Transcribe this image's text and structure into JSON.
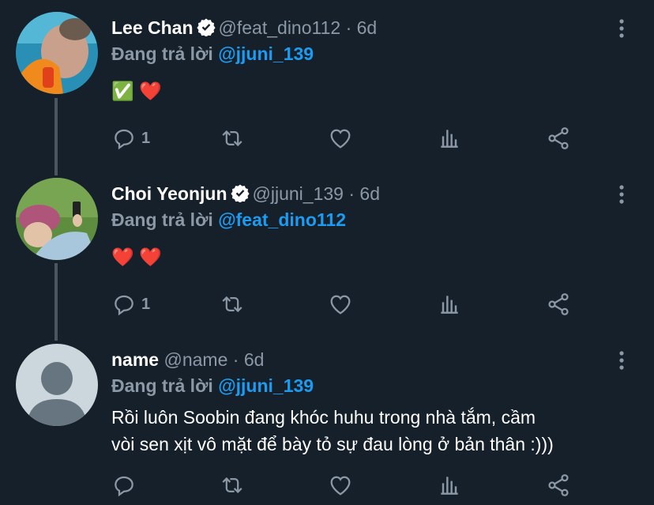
{
  "tweets": [
    {
      "name": "Lee Chan",
      "handle": "@feat_dino112",
      "separator": "·",
      "time": "6d",
      "replying_prefix": "Đang trả lời",
      "replying_to": "@jjuni_139",
      "content": "✅ ❤️",
      "reply_count": "1",
      "verified": true
    },
    {
      "name": "Choi Yeonjun",
      "handle": "@jjuni_139",
      "separator": "·",
      "time": "6d",
      "replying_prefix": "Đang trả lời",
      "replying_to": "@feat_dino112",
      "content": "❤️ ❤️",
      "reply_count": "1",
      "verified": true
    },
    {
      "name": "name",
      "handle": "@name",
      "separator": "·",
      "time": "6d",
      "replying_prefix": "Đang trả lời",
      "replying_to": "@jjuni_139",
      "content_line1": "Rồi luôn Soobin đang khóc huhu trong nhà tắm, cầm",
      "content_line2": "vòi sen xịt vô mặt để bày tỏ sự đau lòng ở bản thân :)))",
      "reply_count": "",
      "verified": false
    }
  ],
  "colors": {
    "background": "#15202b",
    "text": "#ffffff",
    "muted": "#8b98a5",
    "link": "#1d9bf0",
    "thread_line": "#4a5560"
  },
  "icons": [
    "reply-icon",
    "retweet-icon",
    "like-icon",
    "analytics-icon",
    "share-icon",
    "more-icon",
    "verified-badge-icon"
  ]
}
